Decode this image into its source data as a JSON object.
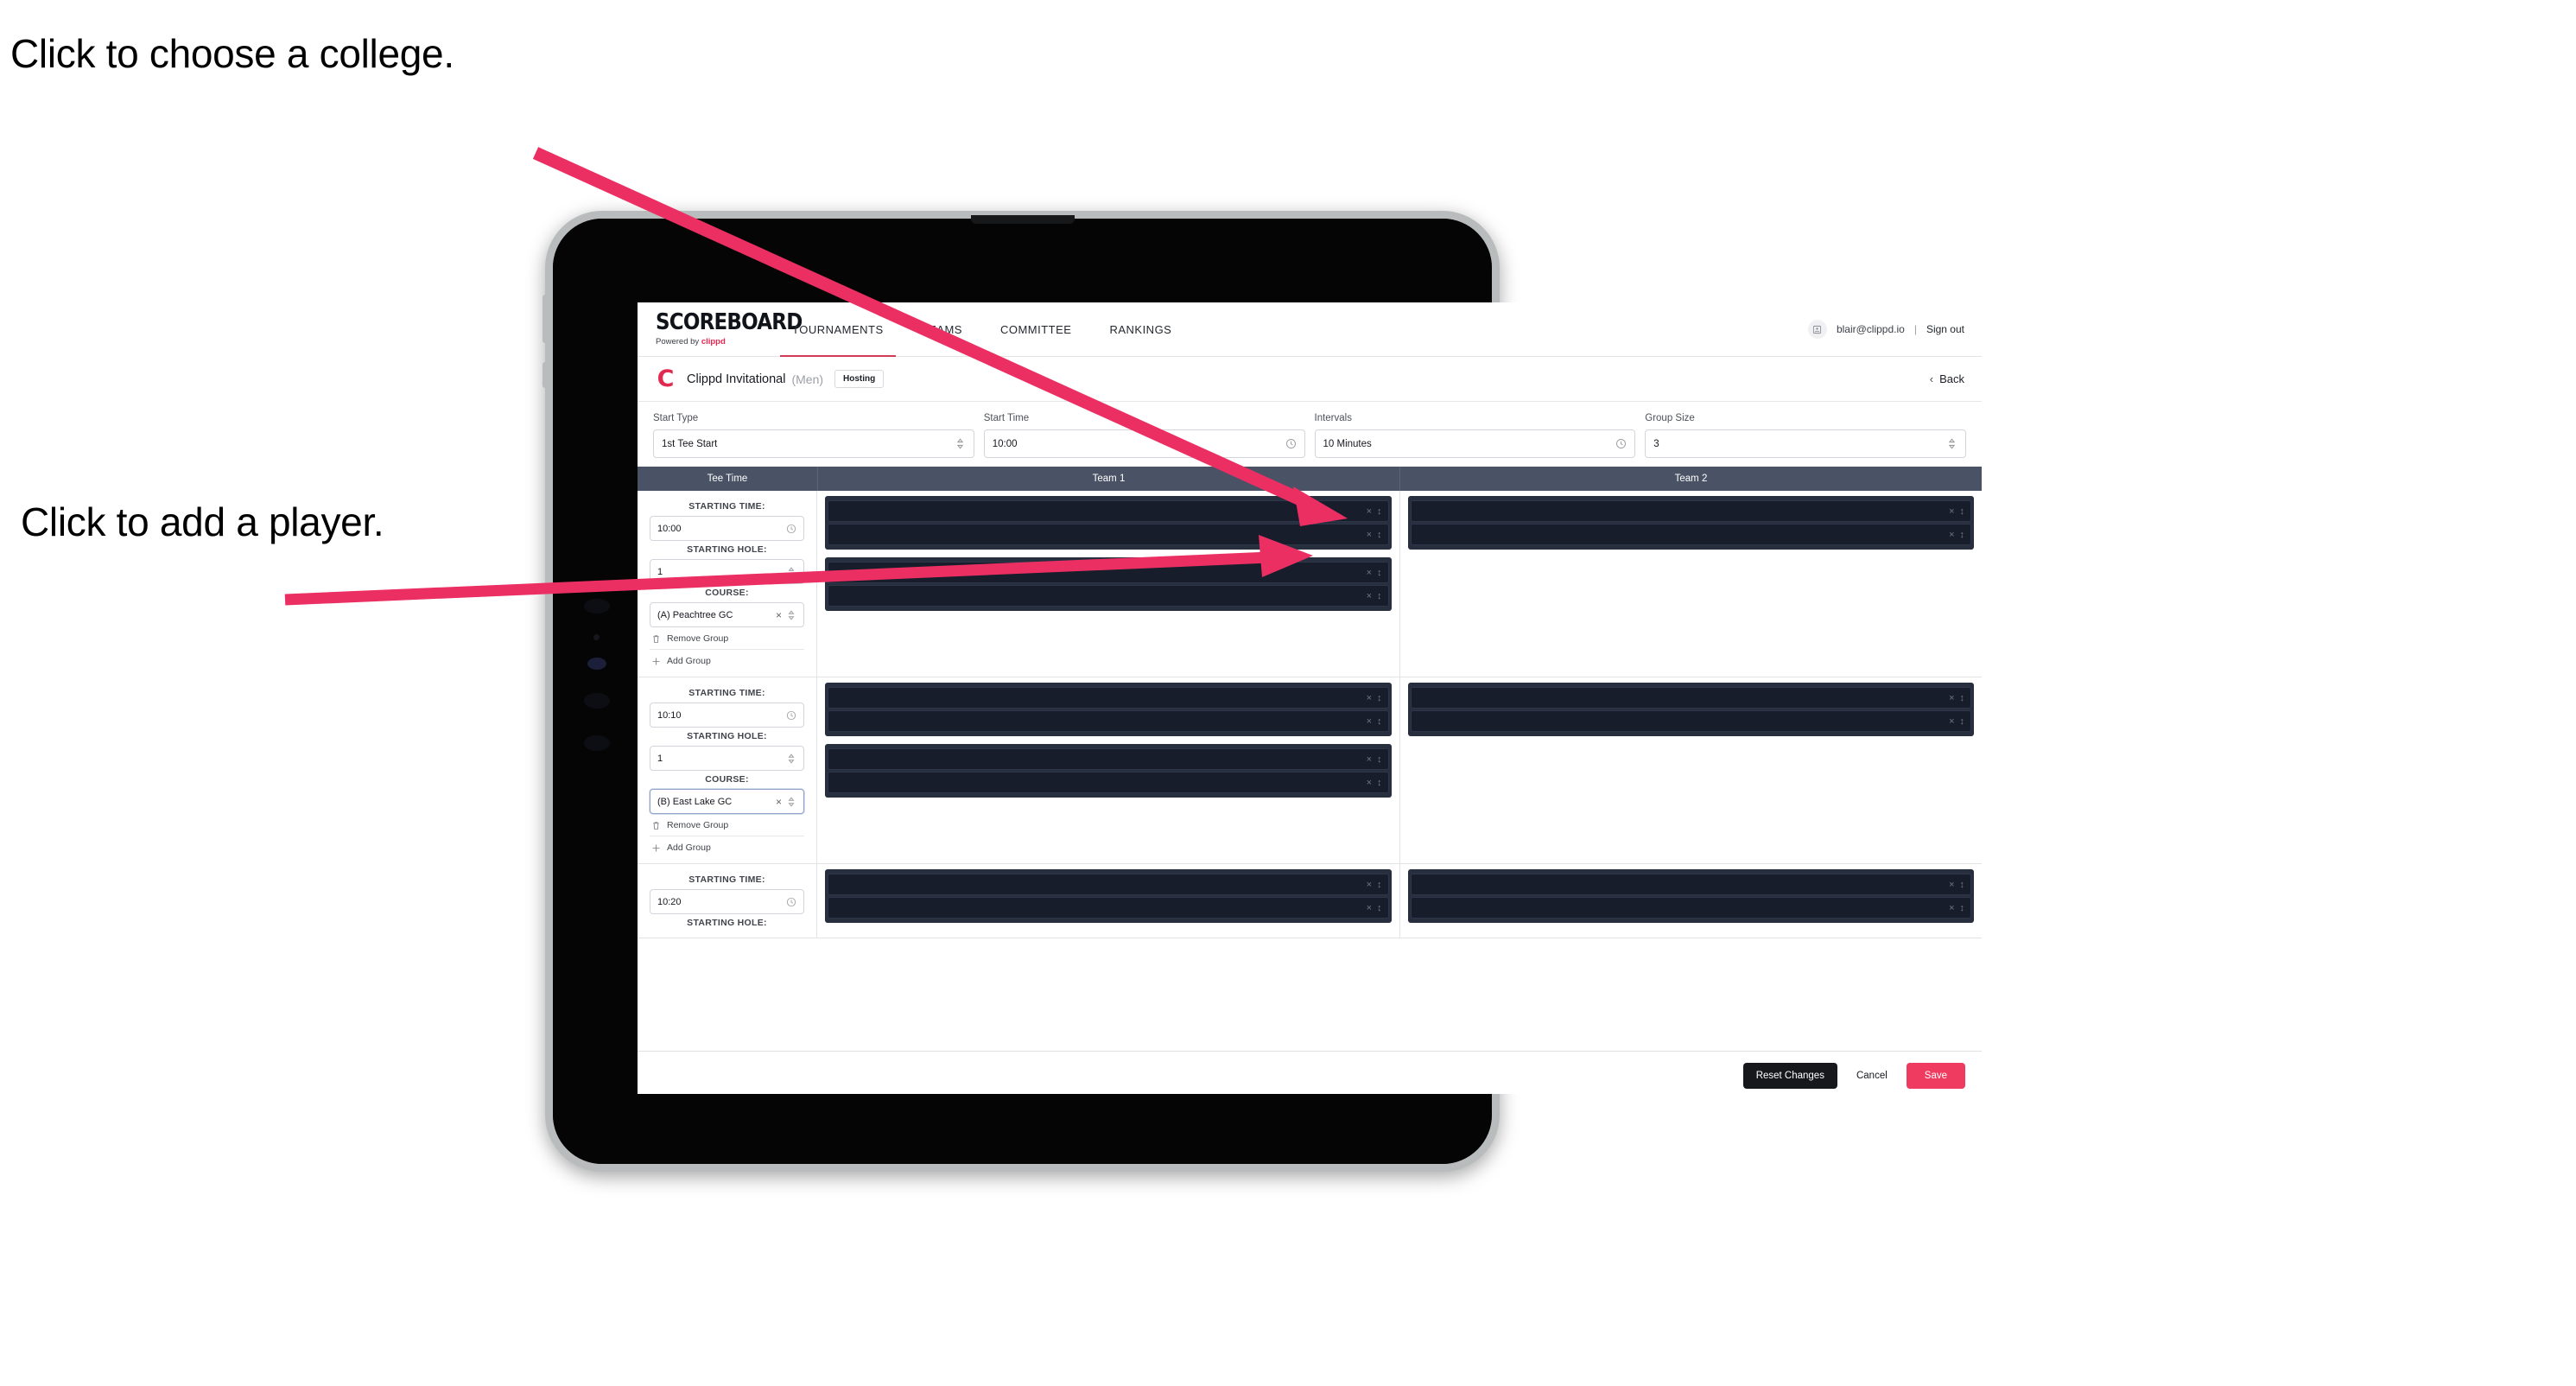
{
  "annotations": {
    "college": "Click to choose a college.",
    "player": "Click to add a player."
  },
  "colors": {
    "accent_pink": "#ef3b5f",
    "arrow_pink": "#ec2f63",
    "header_slate": "#4a5265",
    "panel_dark": "#272e3e",
    "row_dark": "#171d2b"
  },
  "topnav": {
    "logo_main": "SCOREBOARD",
    "logo_sub_prefix": "Powered by ",
    "logo_sub_brand": "clippd",
    "tabs": [
      {
        "label": "TOURNAMENTS",
        "active": true
      },
      {
        "label": "TEAMS",
        "active": false
      },
      {
        "label": "COMMITTEE",
        "active": false
      },
      {
        "label": "RANKINGS",
        "active": false
      }
    ],
    "avatar_icon": "user-avatar-icon",
    "user_email": "blair@clippd.io",
    "separator": "|",
    "sign_out": "Sign out"
  },
  "breadcrumb": {
    "logo_letter": "C",
    "title": "Clippd Invitational",
    "gender": "(Men)",
    "badge": "Hosting",
    "back_chevron": "‹",
    "back_label": "Back"
  },
  "controls": [
    {
      "label": "Start Type",
      "value": "1st Tee Start",
      "icon": "stepper-icon"
    },
    {
      "label": "Start Time",
      "value": "10:00",
      "icon": "clock-icon"
    },
    {
      "label": "Intervals",
      "value": "10 Minutes",
      "icon": "clock-icon"
    },
    {
      "label": "Group Size",
      "value": "3",
      "icon": "stepper-icon"
    }
  ],
  "table": {
    "headers": {
      "tee_time": "Tee Time",
      "team1": "Team 1",
      "team2": "Team 2"
    },
    "field_labels": {
      "starting_time": "STARTING TIME:",
      "starting_hole": "STARTING HOLE:",
      "course": "COURSE:"
    },
    "group_actions": {
      "remove": "Remove Group",
      "add": "Add Group"
    },
    "groups": [
      {
        "starting_time": "10:00",
        "starting_hole": "1",
        "course": "(A) Peachtree GC",
        "course_focused": false,
        "team1_panels": 2,
        "team2_panels": 1,
        "rows_per_panel": 2
      },
      {
        "starting_time": "10:10",
        "starting_hole": "1",
        "course": "(B) East Lake GC",
        "course_focused": true,
        "team1_panels": 2,
        "team2_panels": 1,
        "rows_per_panel": 2
      },
      {
        "starting_time": "10:20",
        "starting_hole": "",
        "course": "",
        "course_focused": false,
        "team1_panels": 1,
        "team2_panels": 1,
        "rows_per_panel": 2
      }
    ],
    "row_icons": {
      "clear": "×",
      "stepper": "⌃"
    }
  },
  "footer": {
    "reset": "Reset Changes",
    "cancel": "Cancel",
    "save": "Save"
  }
}
